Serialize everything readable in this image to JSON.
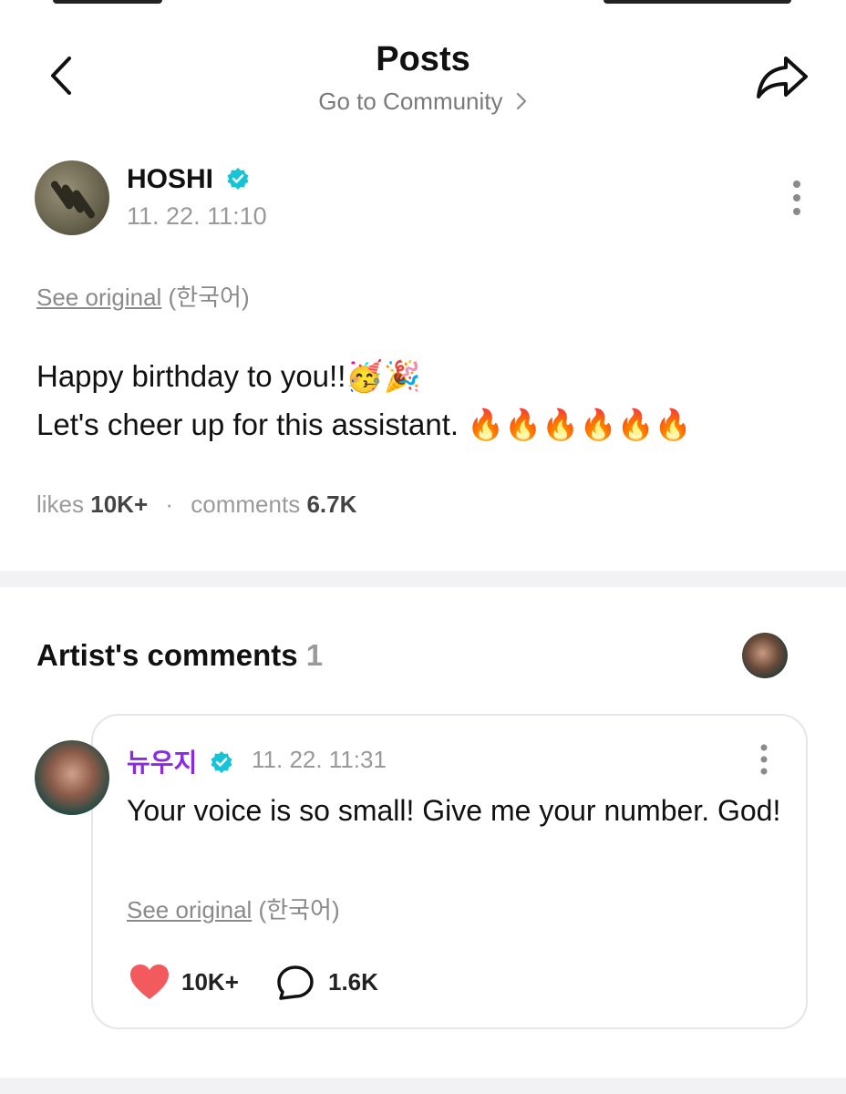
{
  "header": {
    "title": "Posts",
    "subtitle": "Go to Community"
  },
  "post": {
    "author": "HOSHI",
    "time": "11. 22. 11:10",
    "see_original": "See original",
    "language": "(한국어)",
    "line1": "Happy birthday to you!!🥳🎉",
    "line2": "Let's cheer up for this assistant. 🔥🔥🔥🔥🔥🔥",
    "likes_label": "likes",
    "likes_value": "10K+",
    "separator": "·",
    "comments_label": "comments",
    "comments_value": "6.7K"
  },
  "artist_comments": {
    "title": "Artist's comments",
    "count": "1"
  },
  "comment": {
    "author": "뉴우지",
    "time": "11. 22. 11:31",
    "text": "Your voice is so small! Give me your number. God!",
    "see_original": "See original",
    "language": "(한국어)",
    "likes": "10K+",
    "replies": "1.6K"
  },
  "colors": {
    "verified": "#17c3d6",
    "comment_author": "#8a2be2",
    "heart": "#f25a5e",
    "divider": "#f2f2f4"
  },
  "icons": [
    "back-icon",
    "share-icon",
    "verified-icon",
    "more-icon",
    "heart-icon",
    "comment-bubble-icon"
  ]
}
